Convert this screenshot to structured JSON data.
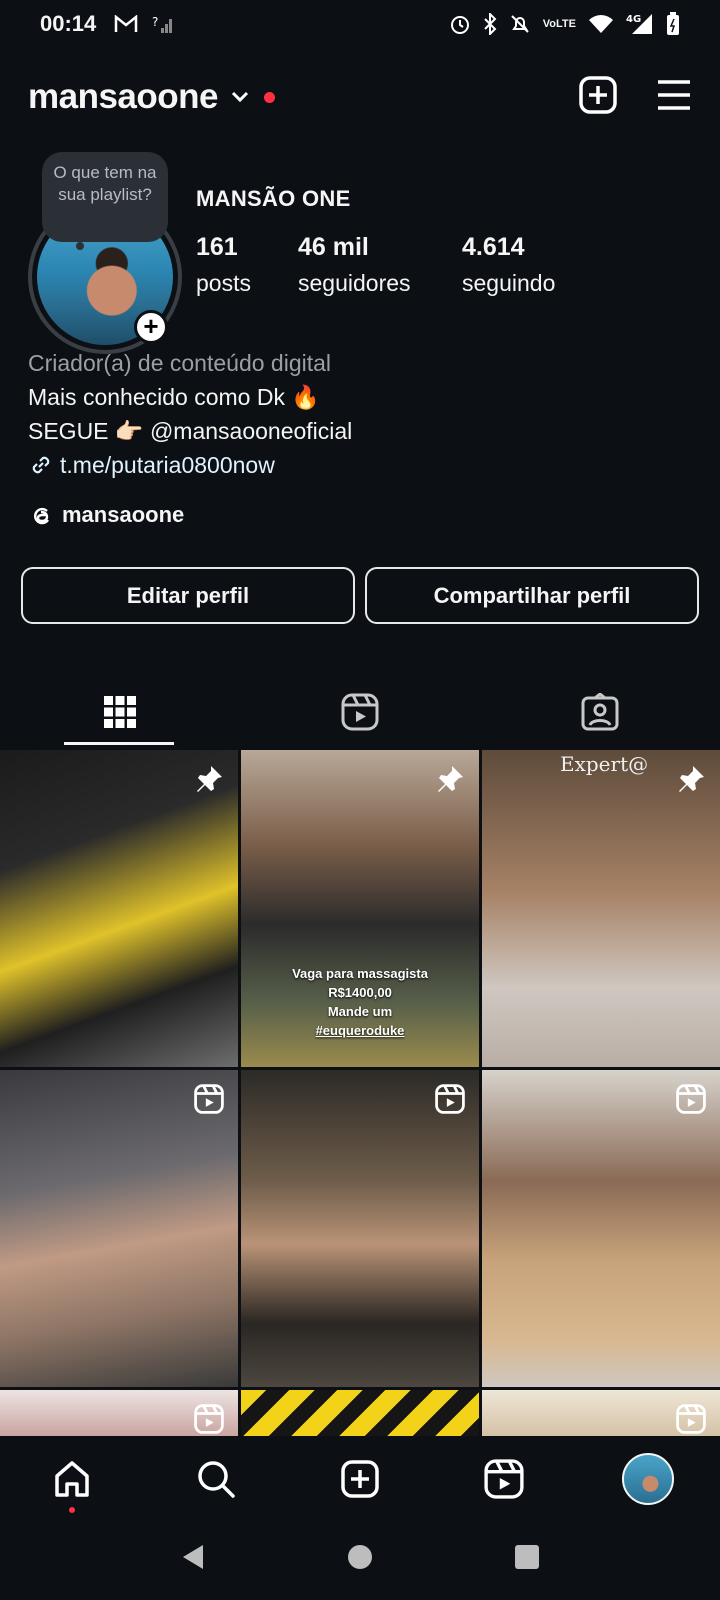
{
  "status_bar": {
    "time": "00:14",
    "volte_top": "Vo",
    "volte_bottom": "LTE",
    "network": "4G"
  },
  "profile": {
    "username": "mansaoone",
    "display_name": "MANSÃO ONE",
    "note": "O que tem na sua playlist?",
    "stats": [
      {
        "value": "161",
        "label": "posts"
      },
      {
        "value": "46 mil",
        "label": "seguidores"
      },
      {
        "value": "4.614",
        "label": "seguindo"
      }
    ],
    "bio": {
      "category": "Criador(a) de conteúdo digital",
      "line1": "Mais conhecido como Dk 🔥",
      "line2": "SEGUE 👉🏻 @mansaooneoficial",
      "link": "t.me/putaria0800now"
    },
    "threads_handle": "mansaoone"
  },
  "buttons": {
    "edit": "Editar perfil",
    "share": "Compartilhar perfil"
  },
  "grid": {
    "post2_caption": [
      "Vaga para massagista",
      "R$1400,00",
      "Mande um",
      "#euqueroduke"
    ],
    "post3_brand": "Expert@"
  },
  "colors": {
    "background": "#0c1014",
    "accent_dot": "#ff3040",
    "link": "#e0f1ff",
    "muted": "#9aa0a6"
  },
  "icons": {
    "header": [
      "create-icon",
      "menu-icon"
    ],
    "tabs": [
      "grid-icon",
      "reels-icon",
      "tagged-icon"
    ],
    "bottom_nav": [
      "home-icon",
      "search-icon",
      "create-icon",
      "reels-icon",
      "profile-avatar"
    ],
    "system_nav": [
      "back-icon",
      "home-icon",
      "recents-icon"
    ]
  }
}
